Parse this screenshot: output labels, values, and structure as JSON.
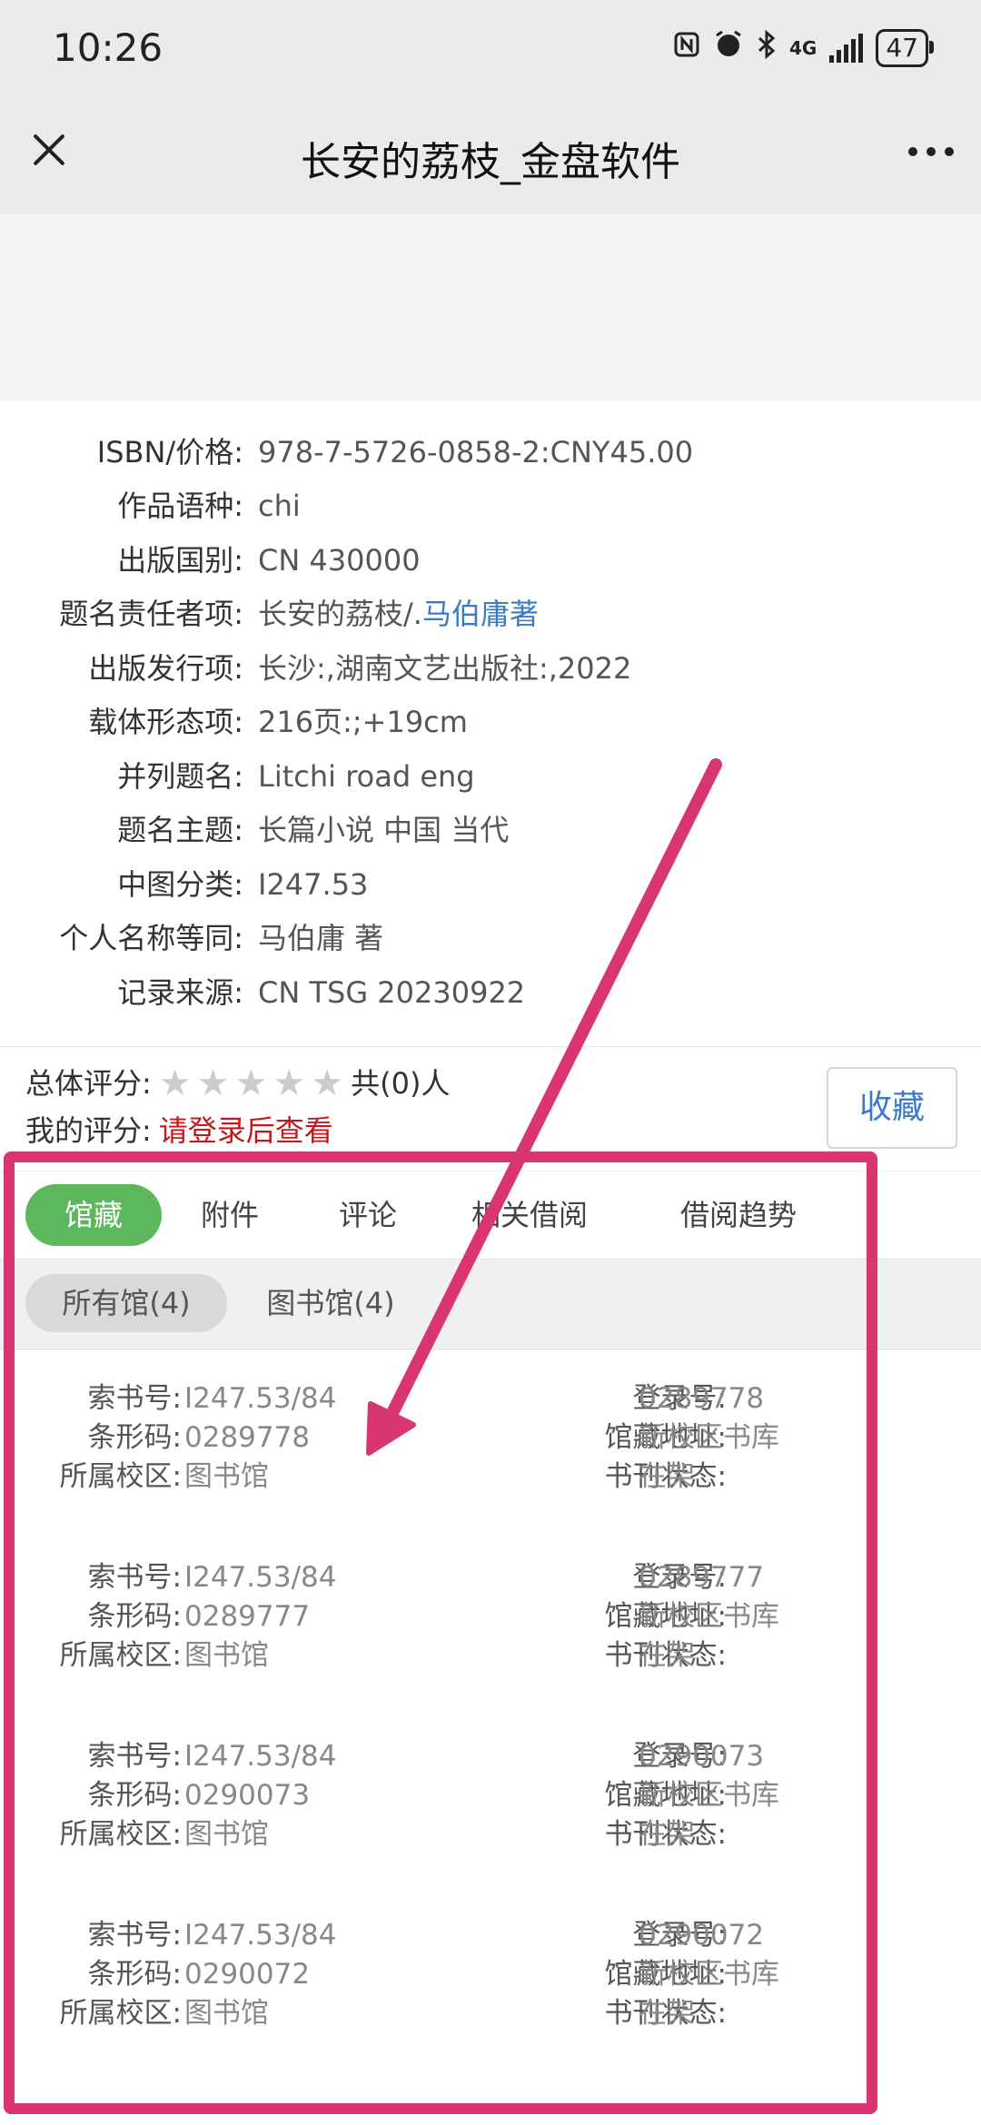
{
  "status_bar": {
    "time": "10:26",
    "network": "4G",
    "battery": "47",
    "icons": [
      "nfc-icon",
      "alarm-icon",
      "bluetooth-icon",
      "signal-icon",
      "battery-icon"
    ]
  },
  "header": {
    "title": "长安的荔枝_金盘软件",
    "close_icon": "close-icon",
    "more_icon": "more-dots-icon"
  },
  "metadata": [
    {
      "label": "ISBN/价格:",
      "value": "978-7-5726-0858-2:CNY45.00"
    },
    {
      "label": "作品语种:",
      "value": "chi"
    },
    {
      "label": "出版国别:",
      "value": "CN 430000"
    },
    {
      "label": "题名责任者项:",
      "value": "长安的荔枝/.",
      "link": "马伯庸著"
    },
    {
      "label": "出版发行项:",
      "value": "长沙:,湖南文艺出版社:,2022"
    },
    {
      "label": "载体形态项:",
      "value": "216页:;+19cm"
    },
    {
      "label": "并列题名:",
      "value": "Litchi road eng"
    },
    {
      "label": "题名主题:",
      "value": "长篇小说 中国 当代"
    },
    {
      "label": "中图分类:",
      "value": "I247.53"
    },
    {
      "label": "个人名称等同:",
      "value": "马伯庸 著"
    },
    {
      "label": "记录来源:",
      "value": "CN TSG 20230922"
    }
  ],
  "rating": {
    "overall_label": "总体评分:",
    "stars_filled": 0,
    "stars_total": 5,
    "count_text": "共(0)人",
    "my_label": "我的评分:",
    "login_hint": "请登录后查看",
    "collect_label": "收藏"
  },
  "tabs": [
    {
      "label": "馆藏",
      "active": true
    },
    {
      "label": "附件",
      "active": false
    },
    {
      "label": "评论",
      "active": false
    },
    {
      "label": "相关借阅",
      "active": false
    },
    {
      "label": "借阅趋势",
      "active": false
    }
  ],
  "filters": [
    {
      "label": "所有馆(4)",
      "active": true
    },
    {
      "label": "图书馆(4)",
      "active": false
    }
  ],
  "holding_labels": {
    "call_no": "索书号:",
    "barcode": "条形码:",
    "campus": "所属校区:",
    "reg_no": "登录号:",
    "location": "馆藏地址:",
    "status": "书刊状态:"
  },
  "holdings": [
    {
      "call_no": "I247.53/84",
      "barcode": "0289778",
      "campus": "图书馆",
      "reg_no": "0289778",
      "location": "新校区书库",
      "status": "在架"
    },
    {
      "call_no": "I247.53/84",
      "barcode": "0289777",
      "campus": "图书馆",
      "reg_no": "0289777",
      "location": "新校区书库",
      "status": "在架"
    },
    {
      "call_no": "I247.53/84",
      "barcode": "0290073",
      "campus": "图书馆",
      "reg_no": "0290073",
      "location": "新校区书库",
      "status": "在架"
    },
    {
      "call_no": "I247.53/84",
      "barcode": "0290072",
      "campus": "图书馆",
      "reg_no": "0290072",
      "location": "新校区书库",
      "status": "在架"
    }
  ],
  "colors": {
    "accent_green": "#5cb85c",
    "link_blue": "#3a7bc8",
    "alert_red": "#c51818",
    "annotation_pink": "#d83572"
  }
}
